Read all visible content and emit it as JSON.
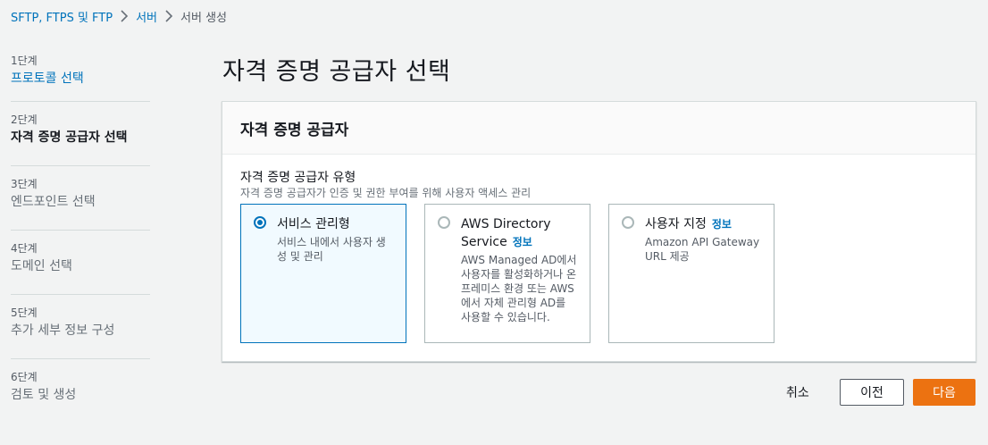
{
  "breadcrumb": {
    "items": [
      "SFTP, FTPS 및 FTP",
      "서버",
      "서버 생성"
    ]
  },
  "steps": [
    {
      "num": "1단계",
      "label": "프로토콜 선택",
      "state": "link"
    },
    {
      "num": "2단계",
      "label": "자격 증명 공급자 선택",
      "state": "active"
    },
    {
      "num": "3단계",
      "label": "엔드포인트 선택",
      "state": "disabled"
    },
    {
      "num": "4단계",
      "label": "도메인 선택",
      "state": "disabled"
    },
    {
      "num": "5단계",
      "label": "추가 세부 정보 구성",
      "state": "disabled"
    },
    {
      "num": "6단계",
      "label": "검토 및 생성",
      "state": "disabled"
    }
  ],
  "page_title": "자격 증명 공급자 선택",
  "panel": {
    "title": "자격 증명 공급자",
    "field_label": "자격 증명 공급자 유형",
    "field_desc": "자격 증명 공급자가 인증 및 권한 부여를 위해 사용자 액세스 관리",
    "options": [
      {
        "title": "서비스 관리형",
        "info": "",
        "desc": "서비스 내에서 사용자 생성 및 관리",
        "selected": true
      },
      {
        "title": "AWS Directory Service",
        "info": "정보",
        "desc": "AWS Managed AD에서 사용자를 활성화하거나 온프레미스 환경 또는 AWS에서 자체 관리형 AD를 사용할 수 있습니다.",
        "selected": false
      },
      {
        "title": "사용자 지정",
        "info": "정보",
        "desc": "Amazon API Gateway URL 제공",
        "selected": false
      }
    ]
  },
  "actions": {
    "cancel": "취소",
    "previous": "이전",
    "next": "다음"
  },
  "colors": {
    "link": "#0073bb",
    "primary_button": "#ec7211",
    "selected_tile_bg": "#f1faff",
    "background": "#f2f3f3"
  },
  "icons": {
    "breadcrumb_separator": "chevron-right-icon",
    "radio": "radio-icon"
  }
}
